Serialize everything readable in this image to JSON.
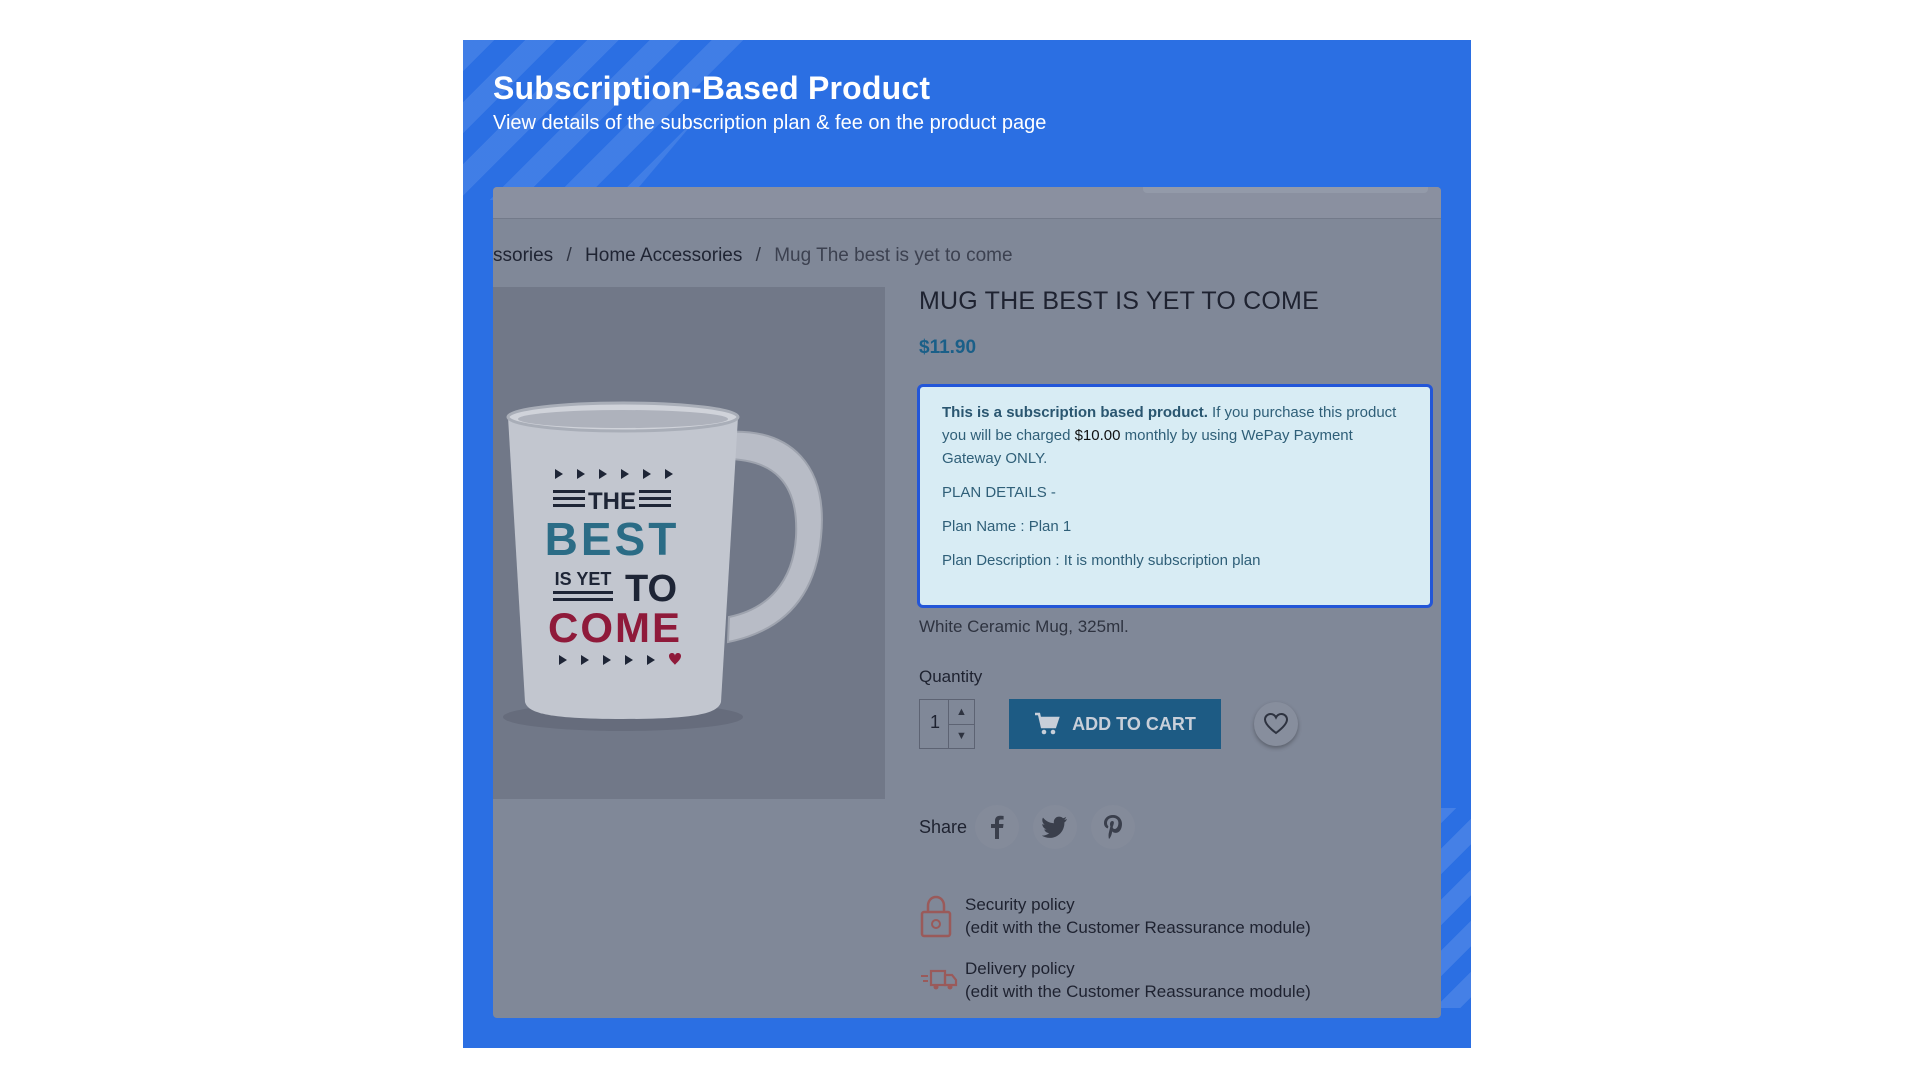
{
  "banner": {
    "title": "Subscription-Based Product",
    "subtitle": "View details of the subscription plan & fee on the product page"
  },
  "breadcrumb": {
    "items": [
      "ssories",
      "Home Accessories",
      "Mug The best is yet to come"
    ],
    "separator": "/"
  },
  "product": {
    "title": "MUG THE BEST IS YET TO COME",
    "price": "$11.90",
    "description": "White Ceramic Mug, 325ml.",
    "image_alt": "Mug The best is yet to come",
    "mug_text": {
      "line1": "THE",
      "line2": "BEST",
      "line3a": "IS YET",
      "line3b": "TO",
      "line4": "COME"
    }
  },
  "subscription": {
    "headline": "This is a subscription based product.",
    "text_before": " If you purchase this product you will be charged ",
    "amount": "$10.00",
    "text_after": " monthly by using WePay Payment Gateway ONLY.",
    "plan_header": "PLAN DETAILS -",
    "plan_name": "Plan Name : Plan 1",
    "plan_description": "Plan Description : It is monthly subscription plan"
  },
  "purchase": {
    "quantity_label": "Quantity",
    "quantity_value": "1",
    "add_to_cart_label": "ADD TO CART"
  },
  "share": {
    "label": "Share",
    "icons": [
      "facebook-icon",
      "twitter-icon",
      "pinterest-icon"
    ]
  },
  "reassurance": [
    {
      "icon": "lock-icon",
      "title": "Security policy",
      "note": "(edit with the Customer Reassurance module)"
    },
    {
      "icon": "truck-icon",
      "title": "Delivery policy",
      "note": "(edit with the Customer Reassurance module)"
    }
  ],
  "colors": {
    "banner": "#2b6fe3",
    "price": "#1a5f88",
    "box_border": "#2356d8",
    "box_bg": "#d8ecf4",
    "cart_button": "#1d5b84"
  }
}
